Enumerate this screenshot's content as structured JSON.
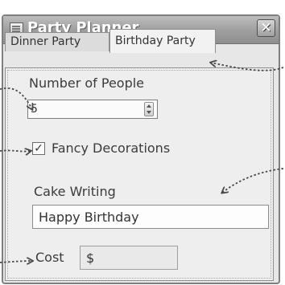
{
  "window": {
    "title": "Party Planner",
    "close_glyph": "✕"
  },
  "tabs": [
    {
      "label": "Dinner Party",
      "selected": false
    },
    {
      "label": "Birthday Party",
      "selected": true
    }
  ],
  "birthday_tab": {
    "number_of_people": {
      "label": "Number of People",
      "value": "5"
    },
    "fancy_decorations": {
      "label": "Fancy Decorations",
      "checked": true,
      "check_glyph": "✓"
    },
    "cake_writing": {
      "label": "Cake Writing",
      "value": "Happy Birthday"
    },
    "cost": {
      "label": "Cost",
      "value": "$"
    }
  },
  "colors": {
    "titlebar": "#9e9e9e",
    "window_bg": "#e7e7e7",
    "annotation_arrow": "#4a4a4a"
  },
  "icons": {
    "app": "app-form-icon",
    "close": "close-icon",
    "spinner": "spinner-arrows-icon"
  }
}
